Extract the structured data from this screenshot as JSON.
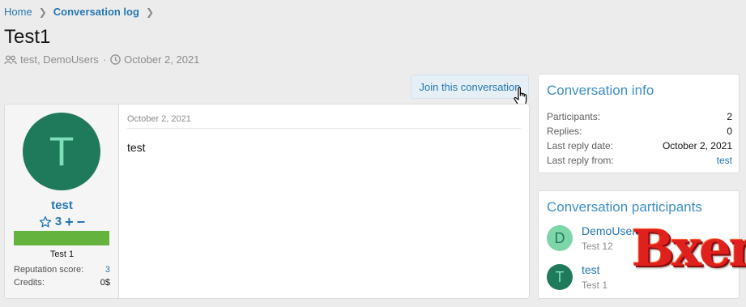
{
  "breadcrumb": {
    "home": "Home",
    "current": "Conversation log"
  },
  "title": "Test1",
  "meta": {
    "participants": "test, DemoUsers",
    "separator": "·",
    "date": "October 2, 2021"
  },
  "join_button": "Join this conversation",
  "message": {
    "date": "October 2, 2021",
    "body": "test",
    "author": {
      "avatar_letter": "T",
      "name": "test",
      "rating": "3",
      "plus": "+",
      "minus": "−",
      "user_title": "Test 1",
      "stats": [
        {
          "label": "Reputation score:",
          "value": "3"
        },
        {
          "label": "Credits:",
          "value": "0$"
        }
      ]
    }
  },
  "info": {
    "title": "Conversation info",
    "rows": [
      {
        "label": "Participants:",
        "value": "2"
      },
      {
        "label": "Replies:",
        "value": "0"
      },
      {
        "label": "Last reply date:",
        "value": "October 2, 2021"
      },
      {
        "label": "Last reply from:",
        "value": "test"
      }
    ]
  },
  "participants": {
    "title": "Conversation participants",
    "items": [
      {
        "letter": "D",
        "name": "DemoUsers",
        "user_title": "Test 12",
        "avatar_bg": "#7ed6a8",
        "avatar_fg": "#1f7a5c"
      },
      {
        "letter": "T",
        "name": "test",
        "user_title": "Test 1",
        "avatar_bg": "#1f7a5c",
        "avatar_fg": "#7ee0b8"
      }
    ]
  },
  "watermark": "Bxen",
  "colors": {
    "link": "#2577b1",
    "block_title": "#3e8ec4",
    "userbar": "#63b33e",
    "avatar": "#1f7a5c"
  }
}
